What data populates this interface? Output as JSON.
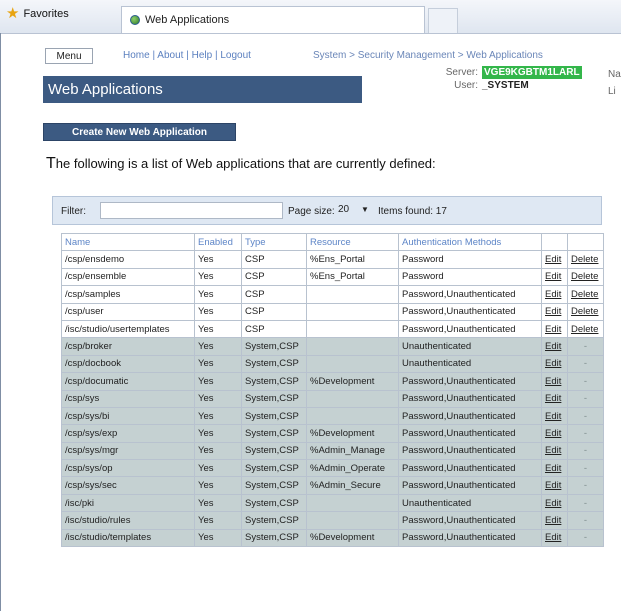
{
  "browser": {
    "favorites_label": "Favorites",
    "tab_title": "Web Applications"
  },
  "nav": {
    "menu_label": "Menu",
    "links": [
      "Home",
      "About",
      "Help",
      "Logout"
    ],
    "breadcrumb": "System > Security Management > Web Applications"
  },
  "header": {
    "title": "Web Applications",
    "server_label": "Server:",
    "server_value": "VGE9KGBTM1LARL",
    "user_label": "User:",
    "user_value": "_SYSTEM",
    "cut_right_1": "Na",
    "cut_right_2": "Li"
  },
  "actions": {
    "create_label": "Create New Web Application"
  },
  "intro_first": "T",
  "intro_rest": "he following is a list of Web applications that are currently defined:",
  "filter": {
    "label": "Filter:",
    "value": "",
    "page_size_label": "Page size:",
    "page_size": "20",
    "items_found": "Items found: 17"
  },
  "table": {
    "columns": [
      "Name",
      "Enabled",
      "Type",
      "Resource",
      "Authentication Methods",
      "",
      ""
    ],
    "edit_label": "Edit",
    "delete_label": "Delete",
    "no_delete": "-",
    "rows": [
      {
        "name": "/csp/ensdemo",
        "enabled": "Yes",
        "type": "CSP",
        "resource": "%Ens_Portal",
        "auth": "Password",
        "deletable": true
      },
      {
        "name": "/csp/ensemble",
        "enabled": "Yes",
        "type": "CSP",
        "resource": "%Ens_Portal",
        "auth": "Password",
        "deletable": true
      },
      {
        "name": "/csp/samples",
        "enabled": "Yes",
        "type": "CSP",
        "resource": "",
        "auth": "Password,Unauthenticated",
        "deletable": true
      },
      {
        "name": "/csp/user",
        "enabled": "Yes",
        "type": "CSP",
        "resource": "",
        "auth": "Password,Unauthenticated",
        "deletable": true
      },
      {
        "name": "/isc/studio/usertemplates",
        "enabled": "Yes",
        "type": "CSP",
        "resource": "",
        "auth": "Password,Unauthenticated",
        "deletable": true
      },
      {
        "name": "/csp/broker",
        "enabled": "Yes",
        "type": "System,CSP",
        "resource": "",
        "auth": "Unauthenticated",
        "deletable": false
      },
      {
        "name": "/csp/docbook",
        "enabled": "Yes",
        "type": "System,CSP",
        "resource": "",
        "auth": "Unauthenticated",
        "deletable": false
      },
      {
        "name": "/csp/documatic",
        "enabled": "Yes",
        "type": "System,CSP",
        "resource": "%Development",
        "auth": "Password,Unauthenticated",
        "deletable": false
      },
      {
        "name": "/csp/sys",
        "enabled": "Yes",
        "type": "System,CSP",
        "resource": "",
        "auth": "Password,Unauthenticated",
        "deletable": false
      },
      {
        "name": "/csp/sys/bi",
        "enabled": "Yes",
        "type": "System,CSP",
        "resource": "",
        "auth": "Password,Unauthenticated",
        "deletable": false
      },
      {
        "name": "/csp/sys/exp",
        "enabled": "Yes",
        "type": "System,CSP",
        "resource": "%Development",
        "auth": "Password,Unauthenticated",
        "deletable": false
      },
      {
        "name": "/csp/sys/mgr",
        "enabled": "Yes",
        "type": "System,CSP",
        "resource": "%Admin_Manage",
        "auth": "Password,Unauthenticated",
        "deletable": false
      },
      {
        "name": "/csp/sys/op",
        "enabled": "Yes",
        "type": "System,CSP",
        "resource": "%Admin_Operate",
        "auth": "Password,Unauthenticated",
        "deletable": false
      },
      {
        "name": "/csp/sys/sec",
        "enabled": "Yes",
        "type": "System,CSP",
        "resource": "%Admin_Secure",
        "auth": "Password,Unauthenticated",
        "deletable": false
      },
      {
        "name": "/isc/pki",
        "enabled": "Yes",
        "type": "System,CSP",
        "resource": "",
        "auth": "Unauthenticated",
        "deletable": false
      },
      {
        "name": "/isc/studio/rules",
        "enabled": "Yes",
        "type": "System,CSP",
        "resource": "",
        "auth": "Password,Unauthenticated",
        "deletable": false
      },
      {
        "name": "/isc/studio/templates",
        "enabled": "Yes",
        "type": "System,CSP",
        "resource": "%Development",
        "auth": "Password,Unauthenticated",
        "deletable": false
      }
    ]
  }
}
